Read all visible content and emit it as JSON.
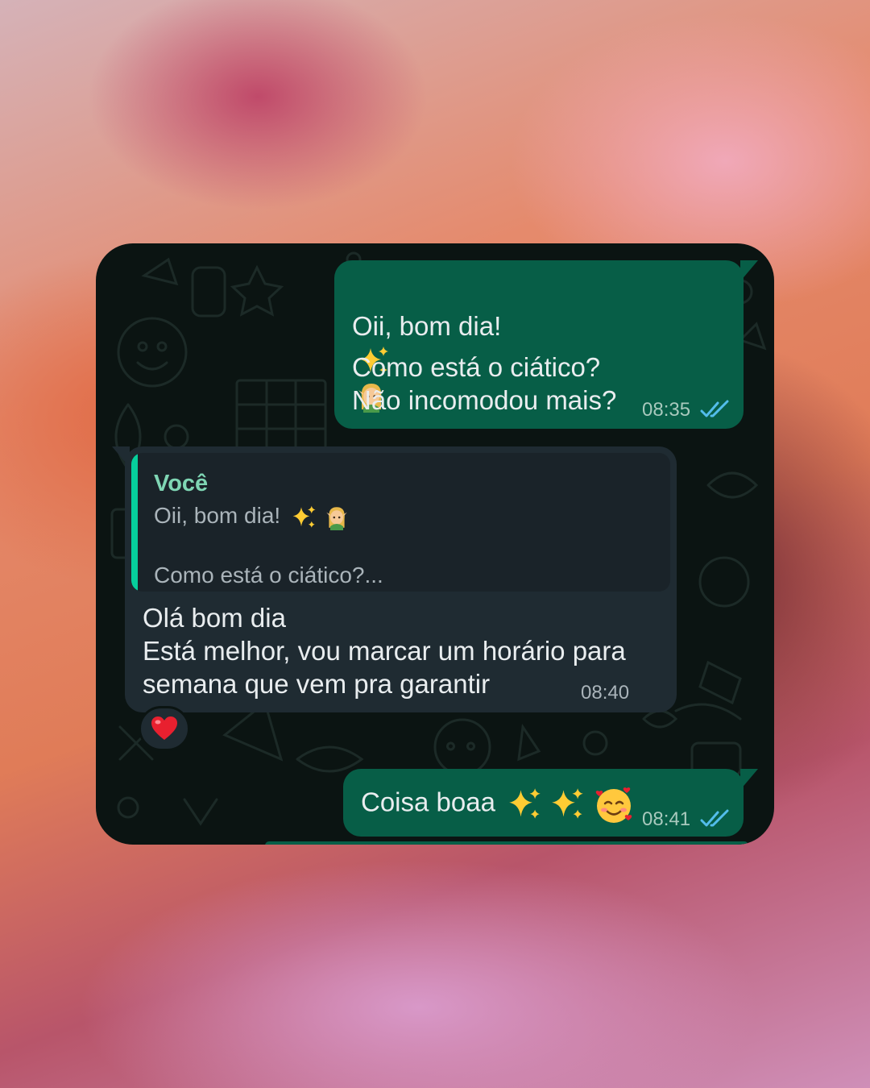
{
  "chat": {
    "messages": [
      {
        "direction": "outgoing",
        "line1": "Oii, bom dia!",
        "line1_emojis": [
          "sparkles-emoji",
          "elf-emoji"
        ],
        "body": "Como está o ciático?\nNão incomodou mais?",
        "time": "08:35",
        "status": "read"
      },
      {
        "direction": "incoming",
        "reply_to": {
          "author": "Você",
          "line1": "Oii, bom dia!",
          "line1_emojis": [
            "sparkles-emoji",
            "elf-emoji"
          ],
          "line2": "Como está o ciático?..."
        },
        "body": "Olá bom dia\nEstá melhor, vou marcar um horário para\nsemana que vem pra garantir",
        "time": "08:40",
        "reaction": "heart-emoji"
      },
      {
        "direction": "outgoing",
        "body": "Coisa boaa",
        "body_emojis": [
          "sparkles-emoji",
          "sparkles-emoji",
          "smiling-face-with-hearts-emoji"
        ],
        "time": "08:41",
        "status": "read"
      }
    ]
  },
  "colors": {
    "outgoing_bubble": "#075e47",
    "incoming_bubble": "#1f2b32",
    "chat_background": "#0b1412",
    "quote_accent": "#06cf9c",
    "read_ticks": "#53bdeb"
  }
}
